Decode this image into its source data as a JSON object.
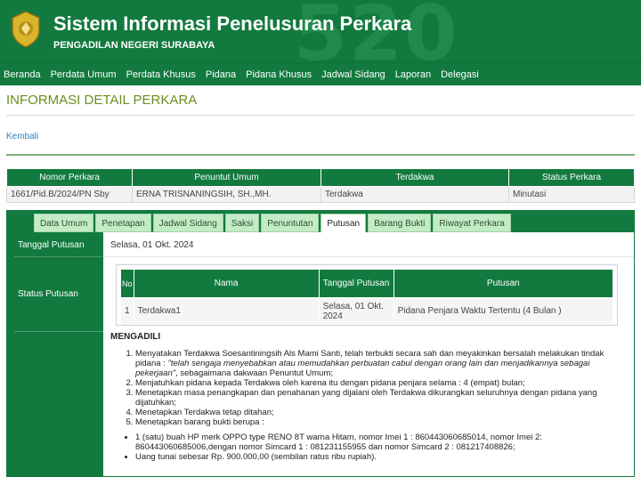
{
  "header": {
    "title": "Sistem Informasi Penelusuran Perkara",
    "subtitle": "PENGADILAN NEGERI SURABAYA",
    "watermark": "520",
    "logo_icon": "court-emblem-icon",
    "bg_color": "#127a3f"
  },
  "nav": [
    "Beranda",
    "Perdata Umum",
    "Perdata Khusus",
    "Pidana",
    "Pidana Khusus",
    "Jadwal Sidang",
    "Laporan",
    "Delegasi"
  ],
  "page": {
    "title": "INFORMASI DETAIL PERKARA",
    "back_label": "Kembali"
  },
  "summary": {
    "headers": [
      "Nomor Perkara",
      "Penuntut Umum",
      "Terdakwa",
      "Status Perkara"
    ],
    "row": [
      "1661/Pid.B/2024/PN Sby",
      "ERNA TRISNANINGSIH, SH.,MH.",
      "Terdakwa",
      "Minutasi"
    ]
  },
  "tabs": [
    "Data Umum",
    "Penetapan",
    "Jadwal Sidang",
    "Saksi",
    "Penuntutan",
    "Putusan",
    "Barang Bukti",
    "Riwayat Perkara"
  ],
  "active_tab": "Putusan",
  "putusan": {
    "tanggal_label": "Tanggal Putusan",
    "tanggal_value": "Selasa, 01 Okt. 2024",
    "status_label": "Status Putusan",
    "table_headers": [
      "No",
      "Nama",
      "Tanggal Putusan",
      "Putusan"
    ],
    "table_row": [
      "1",
      "Terdakwa1",
      "Selasa, 01 Okt. 2024",
      "Pidana Penjara Waktu Tertentu (4 Bulan )"
    ],
    "amar_title": "MENGADILI",
    "amar_items": [
      "Menyatakan Terdakwa Soesantiningsih Als Mami Santi, telah terbukti secara sah dan meyakinkan bersalah melakukan tindak pidana : \"telah sengaja menyebabkan atau memudahkan perbuatan cabul dengan orang lain dan menjadikannya sebagai pekerjaan\", sebagaimana dakwaan Penuntut Umum;",
      "Menjatuhkan pidana kepada Terdakwa oleh karena itu dengan pidana penjara selama : 4 (empat) bulan;",
      "Menetapkan masa penangkapan dan penahanan yang dijalani oleh Terdakwa dikurangkan seluruhnya dengan pidana yang dijatuhkan;",
      "Menetapkan Terdakwa tetap ditahan;",
      "Menetapkan barang bukti berupa :"
    ],
    "barang_bukti": [
      "1 (satu) buah HP merk OPPO type RENO 8T warna Hitam, nomor Imei 1 : 860443060685014, nomor Imei 2: 860443060685006,dengan nomor Simcard 1 : 081231155955 dan nomor Simcard 2 : 081217408826;",
      "Uang tunai sebesar Rp. 900.000,00 (sembilan ratus ribu rupiah)."
    ]
  }
}
